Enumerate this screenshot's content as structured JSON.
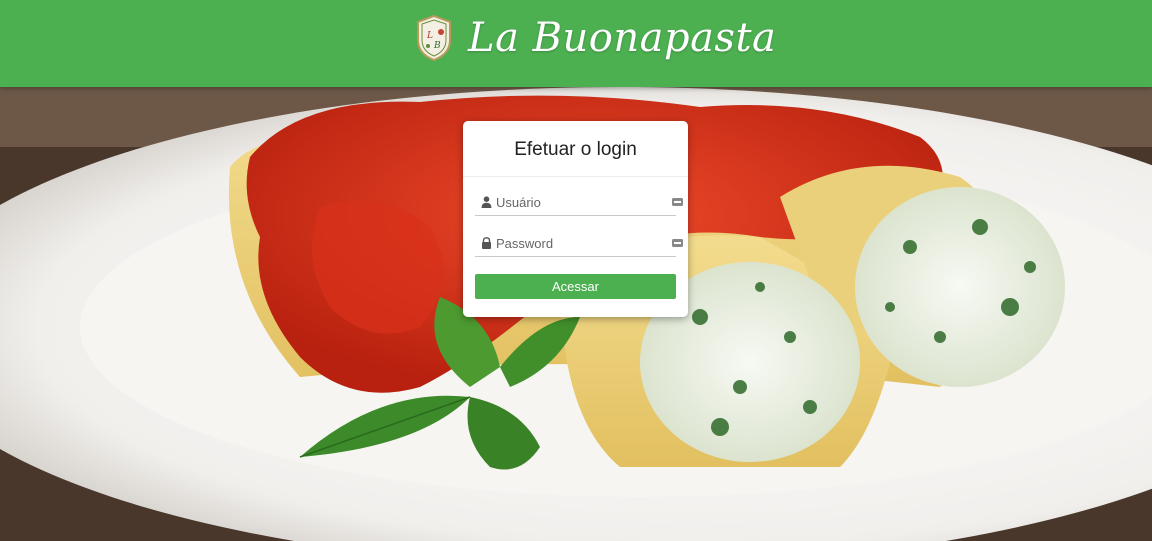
{
  "header": {
    "brand_name": "La Buonapasta",
    "logo_icon": "restaurant-crest-icon",
    "background_color": "#4caf50"
  },
  "hero": {
    "image_description_icon": "cannelloni-dish-photo"
  },
  "login": {
    "title": "Efetuar o login",
    "username": {
      "placeholder": "Usuário",
      "value": "",
      "icon": "user-icon",
      "trailing_icon": "password-manager-key-icon"
    },
    "password": {
      "placeholder": "Password",
      "value": "",
      "icon": "lock-icon",
      "trailing_icon": "password-manager-key-icon"
    },
    "submit_label": "Acessar",
    "accent_color": "#4caf50"
  }
}
